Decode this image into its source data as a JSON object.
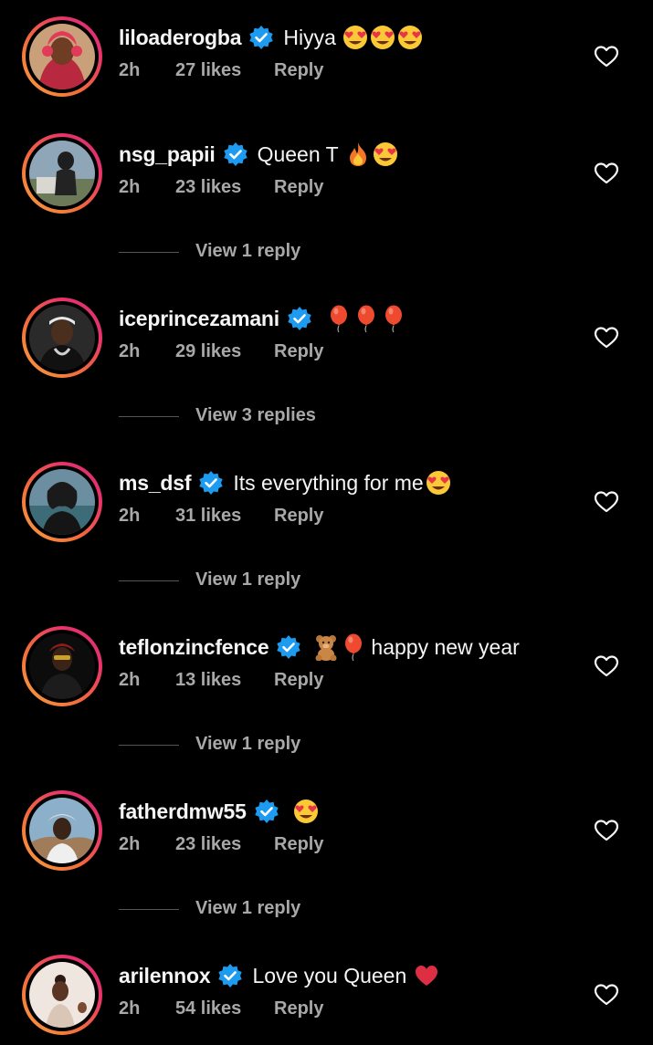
{
  "comments": [
    {
      "username": "liloaderogba",
      "text": "Hiyya",
      "emojis": [
        "heart-eyes",
        "heart-eyes",
        "heart-eyes"
      ],
      "time": "2h",
      "likes": "27 likes",
      "reply": "Reply",
      "view_replies": null
    },
    {
      "username": "nsg_papii",
      "text": "Queen T",
      "emojis": [
        "fire",
        "heart-eyes"
      ],
      "time": "2h",
      "likes": "23 likes",
      "reply": "Reply",
      "view_replies": "View 1 reply"
    },
    {
      "username": "iceprincezamani",
      "text": "",
      "emojis": [
        "balloon",
        "balloon",
        "balloon"
      ],
      "time": "2h",
      "likes": "29 likes",
      "reply": "Reply",
      "view_replies": "View 3 replies"
    },
    {
      "username": "ms_dsf",
      "text": "Its everything for me",
      "emojis": [
        "heart-eyes"
      ],
      "time": "2h",
      "likes": "31 likes",
      "reply": "Reply",
      "view_replies": "View 1 reply"
    },
    {
      "username": "teflonzincfence",
      "text": "happy new year",
      "emojis_before": [
        "teddy-bear",
        "balloon"
      ],
      "emojis": [],
      "time": "2h",
      "likes": "13 likes",
      "reply": "Reply",
      "view_replies": "View 1 reply"
    },
    {
      "username": "fatherdmw55",
      "text": "",
      "emojis": [
        "heart-eyes"
      ],
      "time": "2h",
      "likes": "23 likes",
      "reply": "Reply",
      "view_replies": "View 1 reply"
    },
    {
      "username": "arilennox",
      "text": "Love you Queen",
      "emojis": [
        "red-heart"
      ],
      "time": "2h",
      "likes": "54 likes",
      "reply": "Reply",
      "view_replies": null
    }
  ],
  "colors": {
    "background": "#000000",
    "text": "#f5f5f5",
    "secondary": "#a8a8a8",
    "verified": "#1d9bf0",
    "ring_start": "#f9a23b",
    "ring_end": "#d32f7a"
  }
}
